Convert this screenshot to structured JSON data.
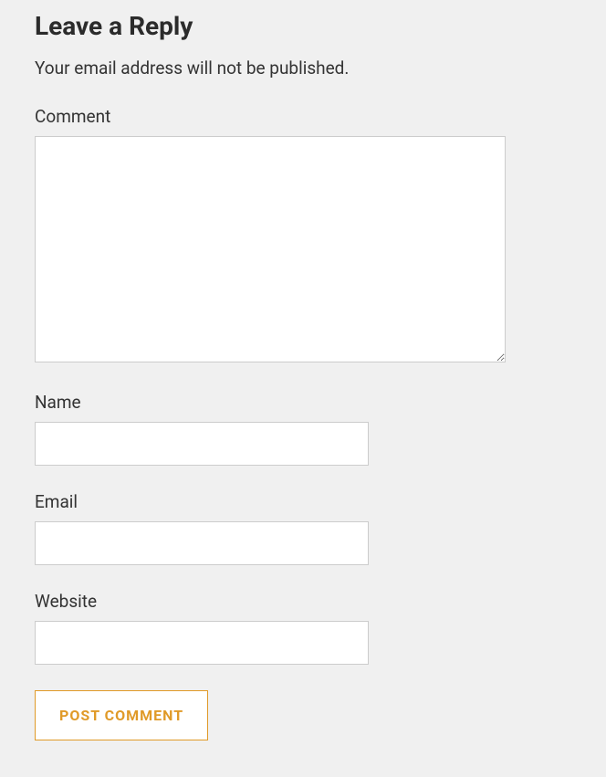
{
  "form": {
    "title": "Leave a Reply",
    "note": "Your email address will not be published.",
    "comment_label": "Comment",
    "name_label": "Name",
    "email_label": "Email",
    "website_label": "Website",
    "submit_label": "POST COMMENT"
  }
}
